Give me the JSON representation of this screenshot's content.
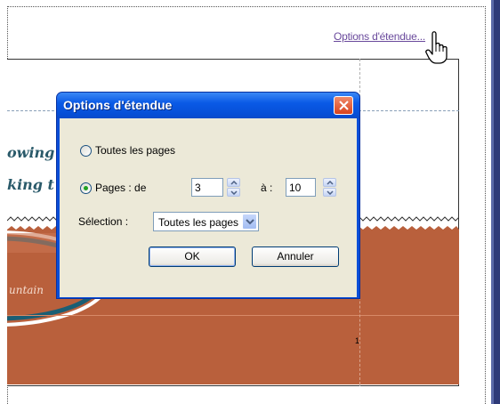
{
  "link": {
    "text": "Options d'étendue..."
  },
  "preview": {
    "line1": "owing",
    "line2": "king t",
    "emblem_text": "untain",
    "page_number": "1"
  },
  "dialog": {
    "title": "Options d'étendue",
    "all_pages_label": "Toutes les pages",
    "pages_label": "Pages : de",
    "from_value": "3",
    "to_label": "à :",
    "to_value": "10",
    "selection_label": "Sélection :",
    "selection_value": "Toutes les pages",
    "ok_label": "OK",
    "cancel_label": "Annuler",
    "selected_option": "pages"
  },
  "colors": {
    "titlebar": "#0a5ae6",
    "dialog_body": "#ece9d8",
    "preview_band": "#b9603c",
    "link": "#6a4a9c",
    "close_button": "#d8431e"
  },
  "icons": {
    "close": "close-icon",
    "spin_up": "chevron-up-icon",
    "spin_down": "chevron-down-icon",
    "dropdown": "chevron-down-icon",
    "cursor": "hand-pointer-icon"
  }
}
